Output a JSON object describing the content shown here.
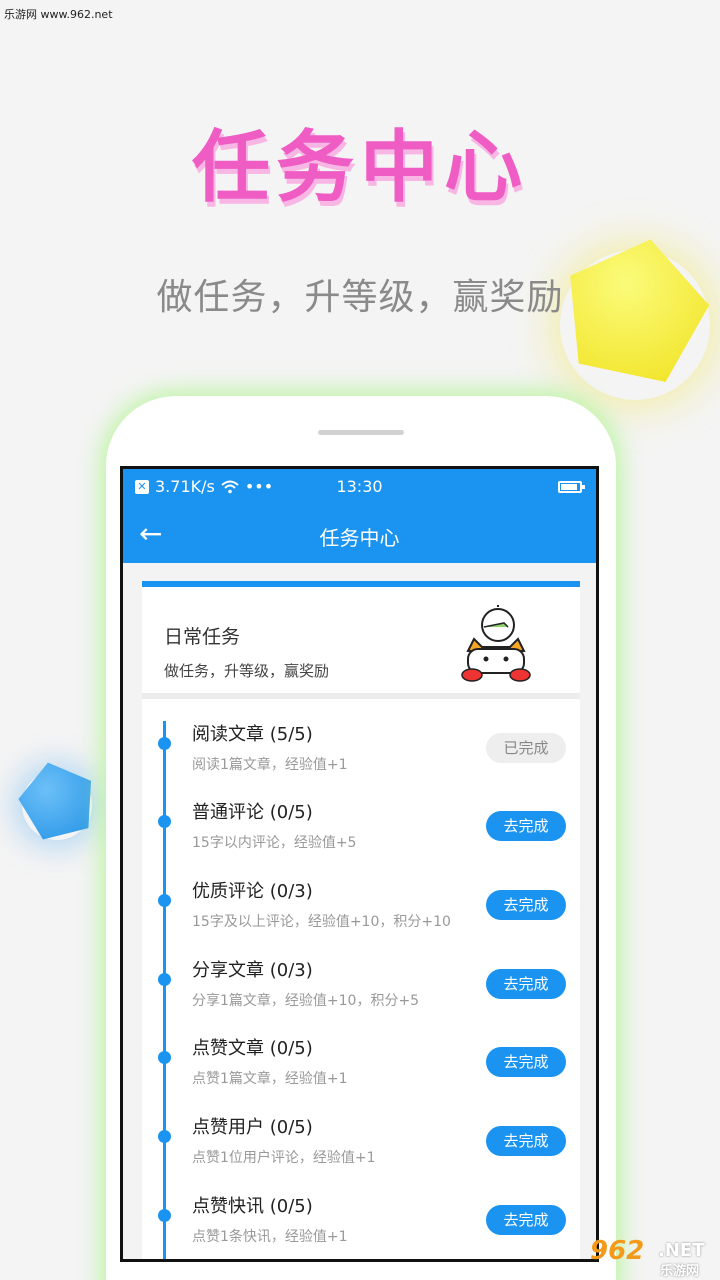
{
  "watermark": {
    "top_text": "乐游网 www.962.net",
    "logo_number": "962",
    "logo_net": ".NET",
    "logo_sub": "乐游网"
  },
  "hero": {
    "title": "任务中心",
    "subtitle": "做任务，升等级，赢奖励"
  },
  "colors": {
    "accent": "#1b94f1",
    "hero_pink": "#ee5cc4",
    "yellow_shape": "#f0e11c",
    "blue_shape": "#2291e6"
  },
  "status_bar": {
    "speed": "3.71K/s",
    "dots": "•••",
    "time": "13:30",
    "icons": [
      "close-box-icon",
      "wifi-icon",
      "battery-icon"
    ]
  },
  "appbar": {
    "back_icon": "←",
    "title": "任务中心"
  },
  "daily": {
    "title": "日常任务",
    "desc": "做任务，升等级，赢奖励"
  },
  "tasks": [
    {
      "title": "阅读文章 (5/5)",
      "desc": "阅读1篇文章，经验值+1",
      "button": "已完成",
      "done": true
    },
    {
      "title": "普通评论 (0/5)",
      "desc": "15字以内评论，经验值+5",
      "button": "去完成",
      "done": false
    },
    {
      "title": "优质评论 (0/3)",
      "desc": "15字及以上评论，经验值+10，积分+10",
      "button": "去完成",
      "done": false
    },
    {
      "title": "分享文章 (0/3)",
      "desc": "分享1篇文章，经验值+10，积分+5",
      "button": "去完成",
      "done": false
    },
    {
      "title": "点赞文章 (0/5)",
      "desc": "点赞1篇文章，经验值+1",
      "button": "去完成",
      "done": false
    },
    {
      "title": "点赞用户 (0/5)",
      "desc": "点赞1位用户评论，经验值+1",
      "button": "去完成",
      "done": false
    },
    {
      "title": "点赞快讯 (0/5)",
      "desc": "点赞1条快讯，经验值+1",
      "button": "去完成",
      "done": false
    }
  ]
}
